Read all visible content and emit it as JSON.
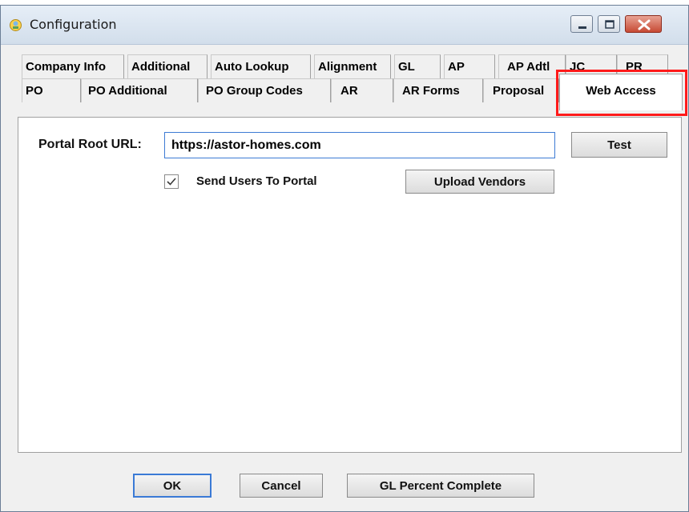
{
  "window": {
    "title": "Configuration",
    "accent_border": "#6b7e96"
  },
  "tabs": {
    "row_back": [
      {
        "label": "Company Info"
      },
      {
        "label": "Additional"
      },
      {
        "label": "Auto Lookup"
      },
      {
        "label": "Alignment"
      },
      {
        "label": "GL"
      },
      {
        "label": "AP"
      },
      {
        "label": "AP Adtl"
      },
      {
        "label": "JC"
      },
      {
        "label": "PR"
      }
    ],
    "row_front": [
      {
        "label": "PO"
      },
      {
        "label": "PO Additional"
      },
      {
        "label": "PO Group Codes"
      },
      {
        "label": "AR"
      },
      {
        "label": "AR Forms"
      },
      {
        "label": "Proposal"
      }
    ],
    "active": {
      "label": "Web Access"
    },
    "highlight_color": "#ff1a1a"
  },
  "web_access": {
    "portal_root_label": "Portal Root URL:",
    "portal_root_value": "https://astor-homes.com",
    "test_button": "Test",
    "send_users_label": "Send Users To Portal",
    "send_users_checked": true,
    "upload_vendors_button": "Upload Vendors"
  },
  "footer": {
    "ok_button": "OK",
    "cancel_button": "Cancel",
    "gl_percent_button": "GL Percent Complete"
  }
}
